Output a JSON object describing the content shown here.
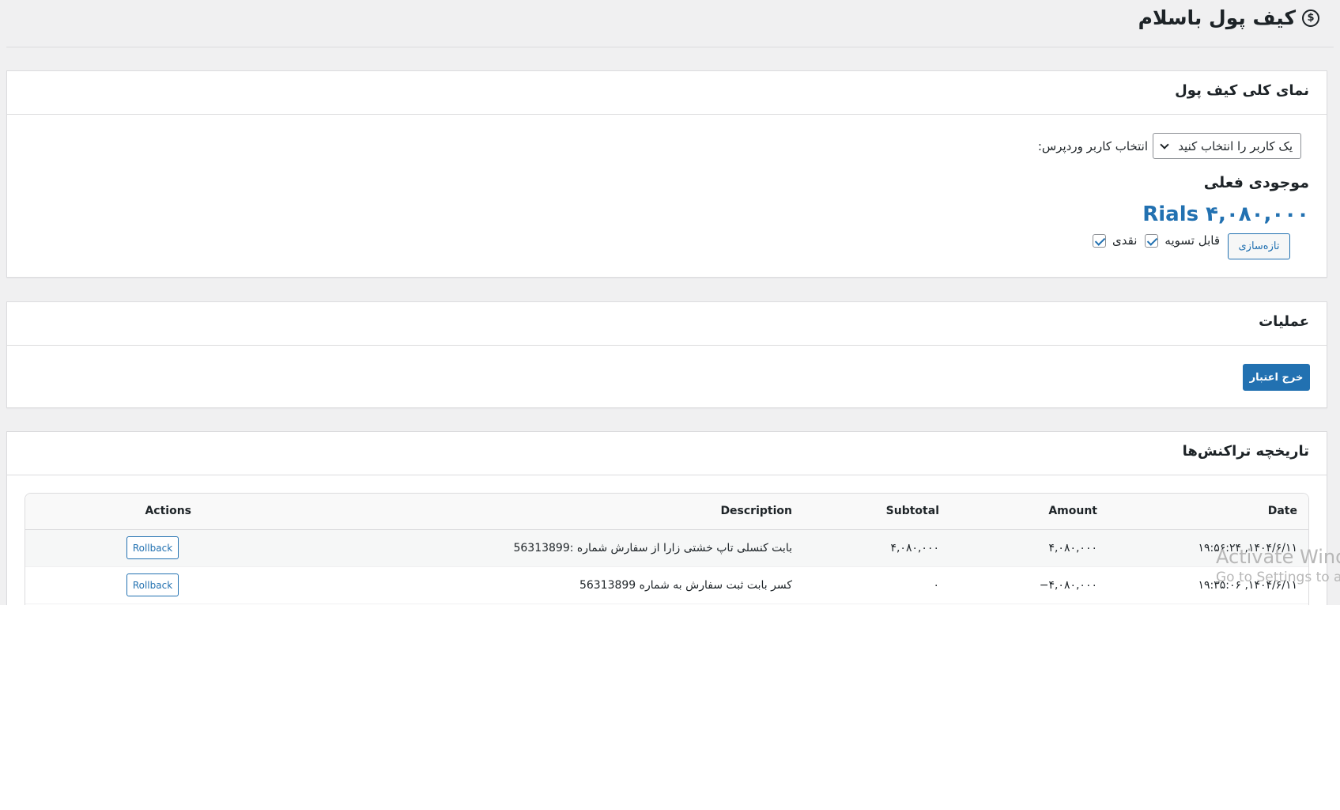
{
  "page": {
    "title": "کیف پول باسلام",
    "icon": "dollar-circle-icon"
  },
  "overview": {
    "title": "نمای کلی کیف پول",
    "select_label": "انتخاب کاربر وردپرس:",
    "select_value": "یک کاربر را انتخاب کنید",
    "balance_heading": "موجودی فعلی",
    "balance_amount": "Rials ۴,۰۸۰,۰۰۰",
    "checks": [
      {
        "label": "نقدی",
        "checked": true
      },
      {
        "label": "قابل تسویه",
        "checked": true
      }
    ],
    "refresh_label": "تازه‌سازی"
  },
  "operations": {
    "title": "عملیات",
    "credit_button": "خرج اعتبار"
  },
  "history": {
    "title": "تاریخچه تراکنش‌ها",
    "columns": {
      "date": "Date",
      "amount": "Amount",
      "subtotal": "Subtotal",
      "description": "Description",
      "actions": "Actions"
    },
    "rows": [
      {
        "date": "۱۹:۵۶:۲۴ ,۱۴۰۴/۶/۱۱",
        "amount": "۴,۰۸۰,۰۰۰",
        "subtotal": "۴,۰۸۰,۰۰۰",
        "description": "بابت کنسلی تاپ خشتی زارا از سفارش شماره :56313899",
        "action": "Rollback"
      },
      {
        "date": "۱۹:۳۵:۰۶ ,۱۴۰۴/۶/۱۱",
        "amount": "−۴,۰۸۰,۰۰۰",
        "subtotal": "۰",
        "description": "کسر بابت ثبت سفارش به شماره 56313899",
        "action": "Rollback"
      }
    ]
  },
  "watermark": {
    "title": "Activate Windows",
    "subtitle": "Go to Settings to activate Windows."
  },
  "colors": {
    "accent": "#2271b1",
    "background": "#f0f0f1",
    "card": "#ffffff",
    "border": "#dcdcde"
  }
}
